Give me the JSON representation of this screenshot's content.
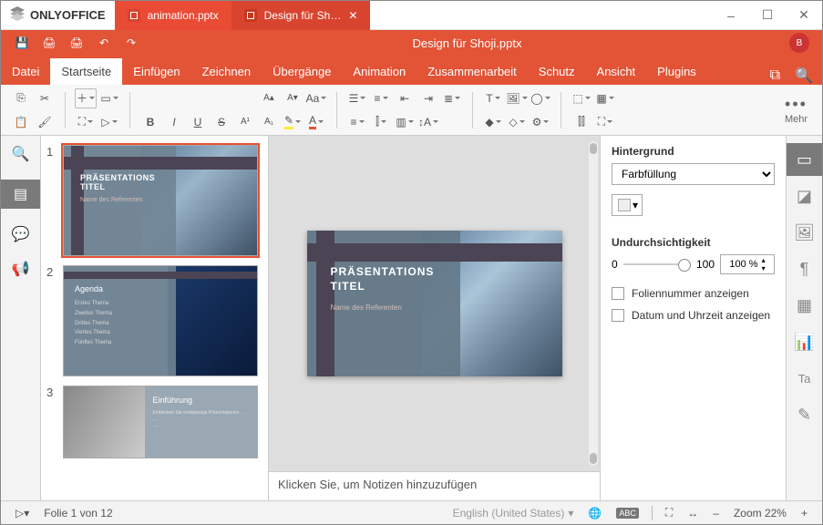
{
  "app": {
    "brand": "ONLYOFFICE"
  },
  "tabs": [
    {
      "label": "animation.pptx",
      "active": false
    },
    {
      "label": "Design für Sh…",
      "active": true
    }
  ],
  "window": {
    "minimize": "–",
    "maximize": "☐",
    "close": "✕"
  },
  "header": {
    "doc_title": "Design für Shoji.pptx",
    "user_initial": "B"
  },
  "qat": {
    "save": "save-icon",
    "print": "print-icon",
    "quickprint": "quickprint-icon",
    "undo": "undo-icon",
    "redo": "redo-icon"
  },
  "menu": {
    "items": [
      "Datei",
      "Startseite",
      "Einfügen",
      "Zeichnen",
      "Übergänge",
      "Animation",
      "Zusammenarbeit",
      "Schutz",
      "Ansicht",
      "Plugins"
    ],
    "active_index": 1
  },
  "toolbar": {
    "more_label": "Mehr"
  },
  "slides": [
    {
      "num": "1",
      "type": "title",
      "title": "PRÄSENTATIONS TITEL",
      "subtitle": "Name des Referenten"
    },
    {
      "num": "2",
      "type": "agenda",
      "title": "Agenda",
      "items": [
        "Erstes Thema",
        "Zweites Thema",
        "Drittes Thema",
        "Viertes Thema",
        "Fünftes Thema"
      ]
    },
    {
      "num": "3",
      "type": "intro",
      "title": "Einführung"
    }
  ],
  "selected_slide_index": 0,
  "slide_main": {
    "title": "PRÄSENTATIONS\nTITEL",
    "subtitle": "Name des Referenten"
  },
  "notes": {
    "placeholder": "Klicken Sie, um Notizen hinzuzufügen"
  },
  "rightpanel": {
    "background_label": "Hintergrund",
    "fill_select": "Farbfüllung",
    "opacity_label": "Undurchsichtigkeit",
    "opacity_min": "0",
    "opacity_max": "100",
    "opacity_value": "100 %",
    "chk_slidenum": "Foliennummer anzeigen",
    "chk_datetime": "Datum und Uhrzeit anzeigen"
  },
  "statusbar": {
    "slide_counter": "Folie 1 von 12",
    "language": "English (United States)",
    "zoom_label": "Zoom 22%"
  },
  "colors": {
    "accent": "#e35336"
  }
}
